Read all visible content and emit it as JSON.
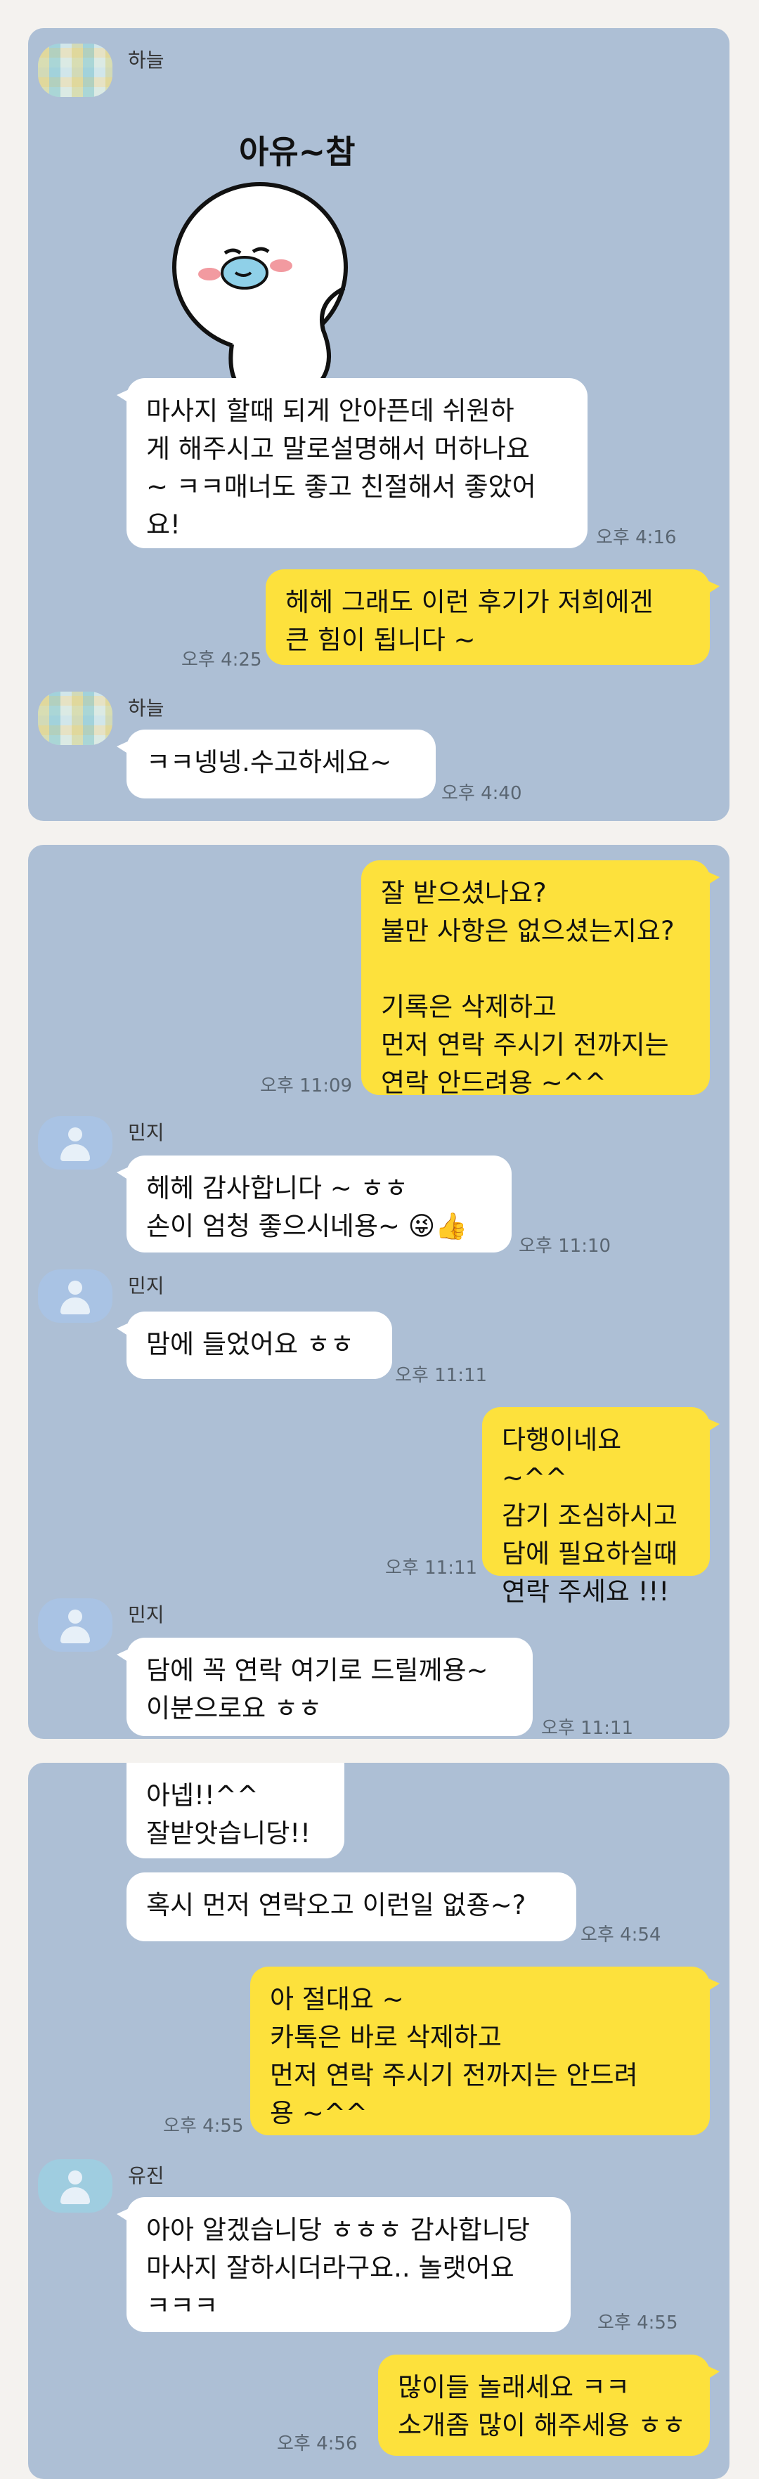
{
  "chat1": {
    "sender": "하늘",
    "sticker_text": "아유~참",
    "msg1": "마사지 할때 되게 안아픈데 쉬원하\n게 해주시고 말로설명해서 머하나요\n~ ㅋㅋ매너도 좋고 친절해서 좋았어\n요!",
    "time1": "오후 4:16",
    "reply": "헤헤 그래도 이런 후기가 저희에겐\n큰 힘이 됩니다 ~",
    "reply_time": "오후 4:25",
    "sender2": "하늘",
    "msg2": "ㅋㅋ넹넹.수고하세요~",
    "time2": "오후 4:40"
  },
  "chat2": {
    "out1": "잘 받으셨나요?\n불만 사항은 없으셨는지요?\n\n기록은 삭제하고\n먼저 연락 주시기 전까지는\n연락 안드려용 ~^^",
    "out1_time": "오후 11:09",
    "sender": "민지",
    "in1": "헤헤 감사합니다 ~ ㅎㅎ\n손이 엄청 좋으시네용~ 😜👍",
    "in1_time": "오후 11:10",
    "in2": "맘에 들었어요 ㅎㅎ",
    "in2_time": "오후 11:11",
    "out2": "다행이네요 ~^^\n감기 조심하시고\n담에 필요하실때\n연락 주세요 !!!",
    "out2_time": "오후 11:11",
    "in3": "담에 꼭 연락 여기로 드릴께용~\n이분으로요 ㅎㅎ",
    "in3_time": "오후 11:11"
  },
  "chat3": {
    "in1": "아넵!!^^\n잘받앗습니당!!",
    "in2": "혹시 먼저 연락오고 이런일 없죵~?",
    "in2_time": "오후 4:54",
    "out1": "아 절대요 ~\n카톡은 바로 삭제하고\n먼저 연락 주시기 전까지는 안드려\n용 ~^^",
    "out1_time": "오후 4:55",
    "sender": "유진",
    "in3": "아아 알겠습니당 ㅎㅎㅎ 감사합니당\n마사지 잘하시더라구요.. 놀랫어요\nㅋㅋㅋ",
    "in3_time": "오후 4:55",
    "out2": "많이들 놀래세요 ㅋㅋ\n소개좀 많이 해주세용 ㅎㅎ",
    "out2_time": "오후 4:56"
  }
}
